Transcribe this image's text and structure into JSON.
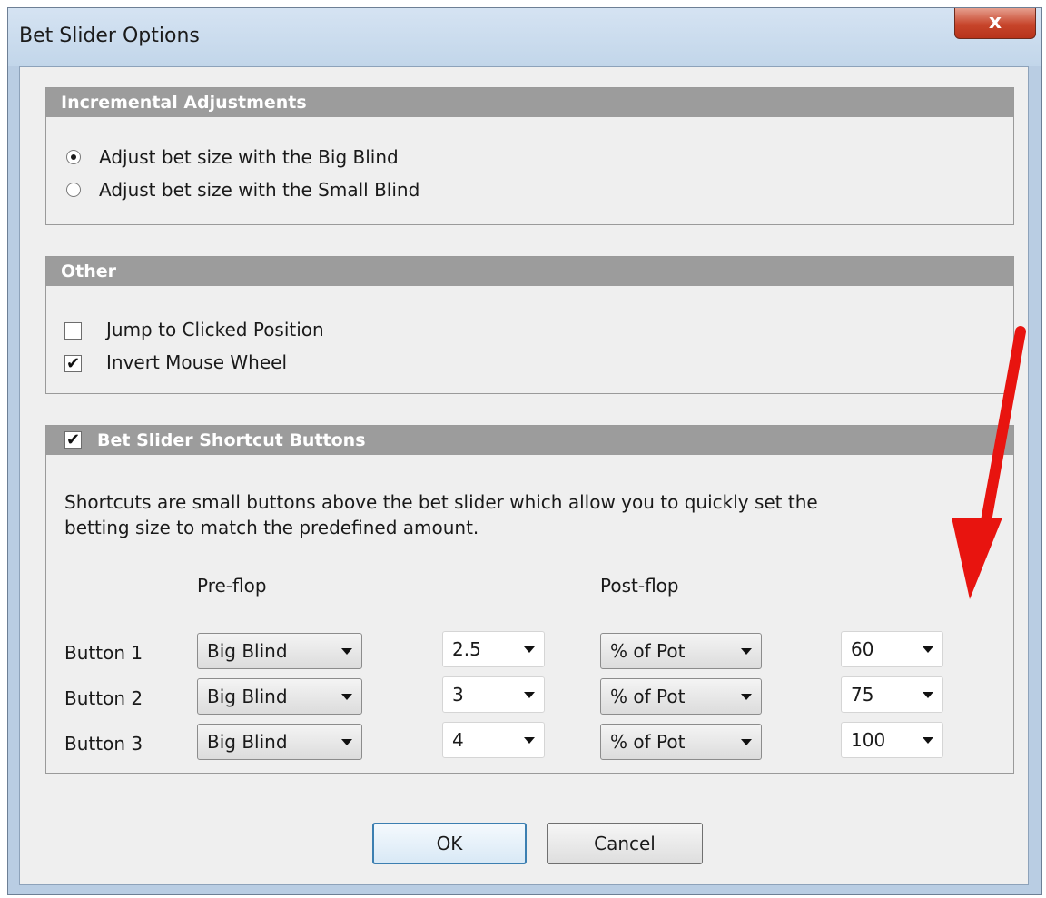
{
  "window": {
    "title": "Bet Slider Options",
    "close_symbol": "x"
  },
  "incremental": {
    "header": "Incremental Adjustments",
    "options": [
      {
        "label": "Adjust bet size with the Big Blind",
        "selected": true
      },
      {
        "label": "Adjust bet size with the Small Blind",
        "selected": false
      }
    ]
  },
  "other": {
    "header": "Other",
    "jump_label": "Jump to Clicked Position",
    "jump_checked": false,
    "invert_label": "Invert Mouse Wheel",
    "invert_checked": true
  },
  "shortcuts": {
    "header": "Bet Slider Shortcut Buttons",
    "enabled": true,
    "description_line1": "Shortcuts are small buttons above the bet slider which allow you to quickly set the",
    "description_line2": "betting size to match the predefined amount.",
    "preflop_heading": "Pre-flop",
    "postflop_heading": "Post-flop",
    "rows": [
      {
        "label": "Button 1",
        "pre_type": "Big Blind",
        "pre_value": "2.5",
        "post_type": "% of Pot",
        "post_value": "60"
      },
      {
        "label": "Button 2",
        "pre_type": "Big Blind",
        "pre_value": "3",
        "post_type": "% of Pot",
        "post_value": "75"
      },
      {
        "label": "Button 3",
        "pre_type": "Big Blind",
        "pre_value": "4",
        "post_type": "% of Pot",
        "post_value": "100"
      }
    ]
  },
  "buttons": {
    "ok": "OK",
    "cancel": "Cancel"
  },
  "colors": {
    "arrow": "#e8140f",
    "group_header": "#9c9c9c"
  },
  "check_mark": "✔"
}
